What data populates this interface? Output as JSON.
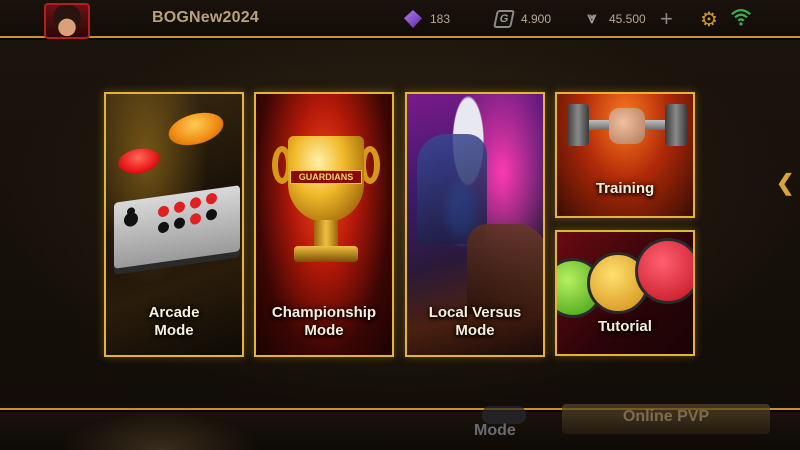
{
  "header": {
    "username": "BOGNew2024",
    "gems": "183",
    "coins": "4.900",
    "credits": "45.500",
    "plus_label": "+",
    "icons": {
      "avatar": "player-avatar",
      "gem": "purple-gem-icon",
      "coin": "g-coin-icon",
      "credit": "wing-credit-icon",
      "settings": "gear-icon",
      "wifi": "wifi-icon"
    }
  },
  "cards": {
    "arcade": {
      "line1": "Arcade",
      "line2": "Mode"
    },
    "championship": {
      "line1": "Championship",
      "line2": "Mode",
      "banner": "GUARDIANS"
    },
    "versus": {
      "line1": "Local Versus",
      "line2": "Mode"
    },
    "training": {
      "label": "Training"
    },
    "tutorial": {
      "label": "Tutorial"
    }
  },
  "side_nav": {
    "arrow": "❮"
  },
  "bottom": {
    "online_pvp": "Online PVP",
    "mode": "Mode"
  },
  "colors": {
    "accent_gold": "#e3b33a",
    "divider_gold": "#c9912a",
    "username": "#b9a27a"
  }
}
